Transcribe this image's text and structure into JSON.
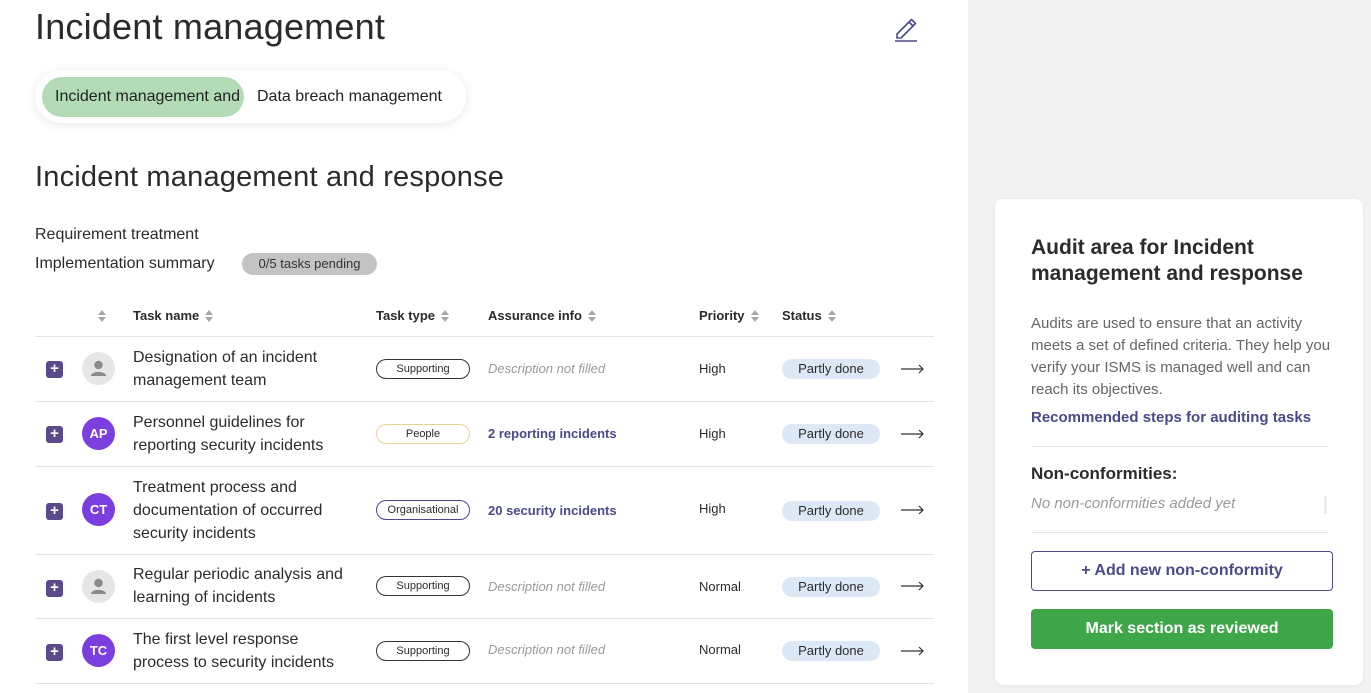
{
  "page": {
    "title": "Incident management"
  },
  "tabs": [
    {
      "label": "Incident management and response"
    },
    {
      "label": "Data breach management"
    }
  ],
  "section": {
    "title": "Incident management and response",
    "requirement_label": "Requirement treatment",
    "implementation_label": "Implementation summary",
    "pending_badge": "0/5 tasks pending"
  },
  "table": {
    "columns": {
      "task_name": "Task name",
      "task_type": "Task type",
      "assurance": "Assurance info",
      "priority": "Priority",
      "status": "Status"
    },
    "rows": [
      {
        "avatar": "",
        "task": "Designation of an incident management team",
        "type": "Supporting",
        "assurance": "Description not filled",
        "priority": "High",
        "status": "Partly done"
      },
      {
        "avatar": "AP",
        "task": "Personnel guidelines for reporting security incidents",
        "type": "People",
        "assurance": "2 reporting incidents",
        "priority": "High",
        "status": "Partly done"
      },
      {
        "avatar": "CT",
        "task": "Treatment process and documentation of occurred security incidents",
        "type": "Organisational",
        "assurance": "20 security incidents",
        "priority": "High",
        "status": "Partly done"
      },
      {
        "avatar": "",
        "task": "Regular periodic analysis and learning of incidents",
        "type": "Supporting",
        "assurance": "Description not filled",
        "priority": "Normal",
        "status": "Partly done"
      },
      {
        "avatar": "TC",
        "task": "The first level response process to security incidents",
        "type": "Supporting",
        "assurance": "Description not filled",
        "priority": "Normal",
        "status": "Partly done"
      }
    ]
  },
  "audit": {
    "title": "Audit area for Incident management and response",
    "description": "Audits are used to ensure that an activity meets a set of defined criteria. They help you verify your ISMS is managed well and can reach its objectives.",
    "steps_link": "Recommended steps for auditing tasks",
    "nc_title": "Non-conformities:",
    "nc_empty": "No non-conformities added yet",
    "add_button": "+ Add new non-conformity",
    "review_button": "Mark section as reviewed"
  },
  "colors": {
    "accent_purple": "#4b4a8a",
    "tab_active_green": "#b3dcb6",
    "review_green": "#3fa64a",
    "avatar_purple": "#7b3fe0",
    "status_blue": "#dde8f7"
  },
  "icons": {
    "edit": "pencil-icon",
    "expand": "plus-icon",
    "open": "arrow-right-icon",
    "sort": "sort-icon",
    "user": "user-icon"
  }
}
